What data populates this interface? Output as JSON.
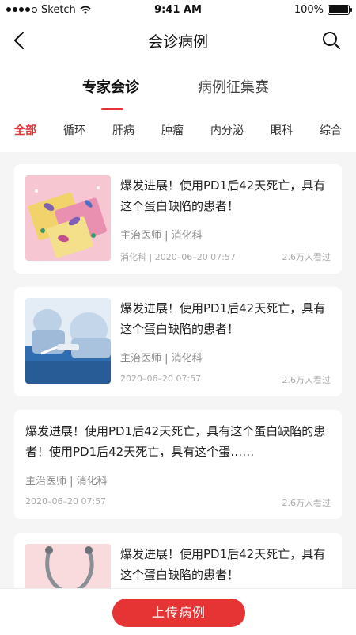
{
  "status_bar": {
    "carrier": "Sketch",
    "time": "9:41 AM",
    "battery": "100%",
    "battery_level": 1.0
  },
  "nav": {
    "title": "会诊病例"
  },
  "main_tabs": [
    {
      "label": "专家会诊",
      "active": true
    },
    {
      "label": "病例征集赛",
      "active": false
    }
  ],
  "category_tabs": [
    {
      "label": "全部",
      "active": true
    },
    {
      "label": "循环"
    },
    {
      "label": "肝病"
    },
    {
      "label": "肿瘤"
    },
    {
      "label": "内分泌"
    },
    {
      "label": "眼科"
    },
    {
      "label": "综合"
    }
  ],
  "cases": [
    {
      "title": "爆发进展！使用PD1后42天死亡，具有这个蛋白缺陷的患者！",
      "meta": "主治医师 | 消化科",
      "footer_left": "消化科 | 2020–06–20 07:57",
      "views": "2.6万人看过",
      "thumb": "pink-cards"
    },
    {
      "title": "爆发进展！使用PD1后42天死亡，具有这个蛋白缺陷的患者！",
      "meta": "主治医师 | 消化科",
      "footer_left": "2020–06–20 07:57",
      "views": "2.6万人看过",
      "thumb": "surgery"
    },
    {
      "title": "爆发进展！使用PD1后42天死亡，具有这个蛋白缺陷的患者！使用PD1后42天死亡，具有这个蛋……",
      "meta": "主治医师 | 消化科",
      "footer_left": "2020–06–20 07:57",
      "views": "2.6万人看过",
      "thumb": null
    },
    {
      "title": "爆发进展！使用PD1后42天死亡，具有这个蛋白缺陷的患者！",
      "thumb": "stethoscope"
    }
  ],
  "bottom": {
    "upload_label": "上传病例"
  },
  "colors": {
    "accent": "#e63333",
    "background": "#f5f5f5"
  }
}
